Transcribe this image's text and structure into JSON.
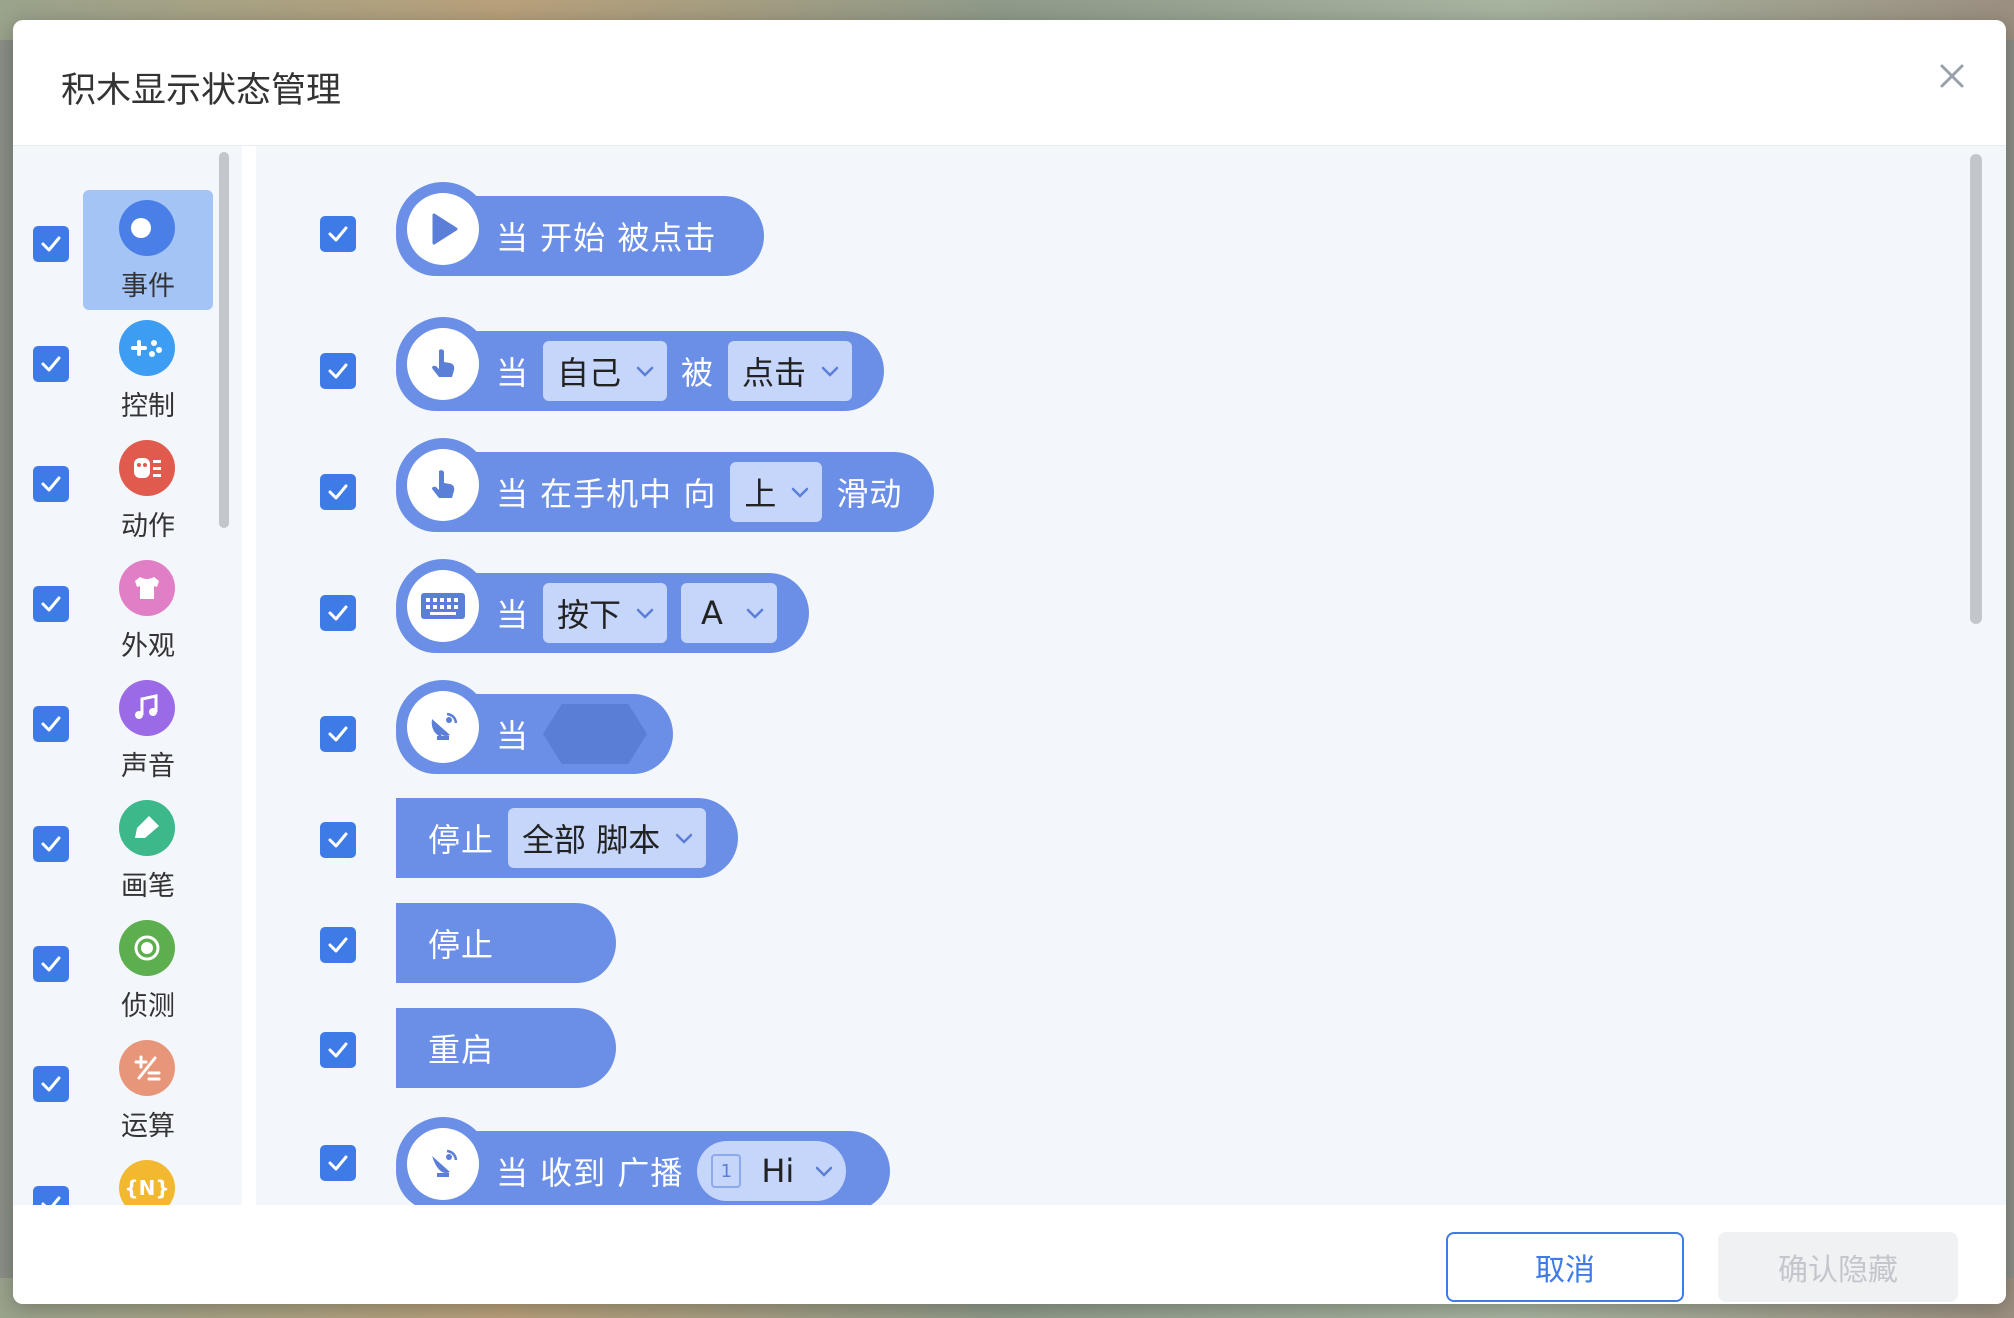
{
  "dialog": {
    "title": "积木显示状态管理",
    "close_icon": "close-icon"
  },
  "sidebar": {
    "items": [
      {
        "label": "事件",
        "icon": "toggle-icon",
        "color": "#4a7fe8",
        "checked": true,
        "active": true
      },
      {
        "label": "控制",
        "icon": "gamepad-icon",
        "color": "#3d9df2",
        "checked": true
      },
      {
        "label": "动作",
        "icon": "robot-icon",
        "color": "#e05a4e",
        "checked": true
      },
      {
        "label": "外观",
        "icon": "shirt-icon",
        "color": "#e07fc6",
        "checked": true
      },
      {
        "label": "声音",
        "icon": "music-icon",
        "color": "#9b6ae6",
        "checked": true
      },
      {
        "label": "画笔",
        "icon": "pen-icon",
        "color": "#3cb88a",
        "checked": true
      },
      {
        "label": "侦测",
        "icon": "radar-icon",
        "color": "#5dae4f",
        "checked": true
      },
      {
        "label": "运算",
        "icon": "math-icon",
        "color": "#e8967a",
        "checked": true
      },
      {
        "label": "",
        "icon": "variable-icon",
        "color": "#f2b830",
        "checked": true,
        "glyph": "{N}"
      }
    ]
  },
  "blocks": [
    {
      "checked": true,
      "icon": "play-icon",
      "parts": [
        "当 开始 被点击"
      ]
    },
    {
      "checked": true,
      "icon": "hand-pointer-icon",
      "t1": "当",
      "d1": "自己",
      "t2": "被",
      "d2": "点击"
    },
    {
      "checked": true,
      "icon": "hand-pointer-icon",
      "t1": "当 在手机中 向",
      "d1": "上",
      "t2": "滑动"
    },
    {
      "checked": true,
      "icon": "keyboard-icon",
      "t1": "当",
      "d1": "按下",
      "d2": "A"
    },
    {
      "checked": true,
      "icon": "satellite-dish-icon",
      "t1": "当"
    },
    {
      "checked": true,
      "t1": "停止",
      "d1": "全部 脚本"
    },
    {
      "checked": true,
      "t1": "停止"
    },
    {
      "checked": true,
      "t1": "重启"
    },
    {
      "checked": true,
      "icon": "satellite-dish-icon",
      "t1": "当 收到 广播",
      "d1_badge": "1",
      "d1": "Hi"
    }
  ],
  "footer": {
    "cancel_label": "取消",
    "confirm_label": "确认隐藏"
  },
  "colors": {
    "block": "#6b8fe6",
    "dropdown": "#c5d6fa",
    "accent": "#3f7be6"
  }
}
